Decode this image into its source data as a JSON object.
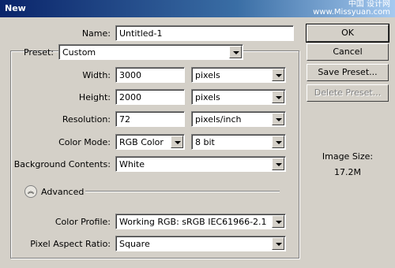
{
  "window": {
    "title": "New"
  },
  "watermark": {
    "line1": "中国 设计网",
    "line2": "www.Missyuan.com"
  },
  "form": {
    "name": {
      "label": "Name:",
      "value": "Untitled-1"
    },
    "preset": {
      "label": "Preset:",
      "value": "Custom"
    },
    "width": {
      "label": "Width:",
      "value": "3000",
      "unit": "pixels"
    },
    "height": {
      "label": "Height:",
      "value": "2000",
      "unit": "pixels"
    },
    "resolution": {
      "label": "Resolution:",
      "value": "72",
      "unit": "pixels/inch"
    },
    "color_mode": {
      "label": "Color Mode:",
      "value": "RGB Color",
      "depth": "8 bit"
    },
    "background": {
      "label": "Background Contents:",
      "value": "White"
    },
    "advanced": {
      "label": "Advanced",
      "toggle_icon": "double-chevron-up"
    },
    "color_profile": {
      "label": "Color Profile:",
      "value": "Working RGB:  sRGB IEC61966-2.1"
    },
    "pixel_aspect": {
      "label": "Pixel Aspect Ratio:",
      "value": "Square"
    }
  },
  "buttons": {
    "ok": "OK",
    "cancel": "Cancel",
    "save_preset": "Save Preset...",
    "delete_preset": "Delete Preset..."
  },
  "image_size": {
    "label": "Image Size:",
    "value": "17.2M"
  }
}
